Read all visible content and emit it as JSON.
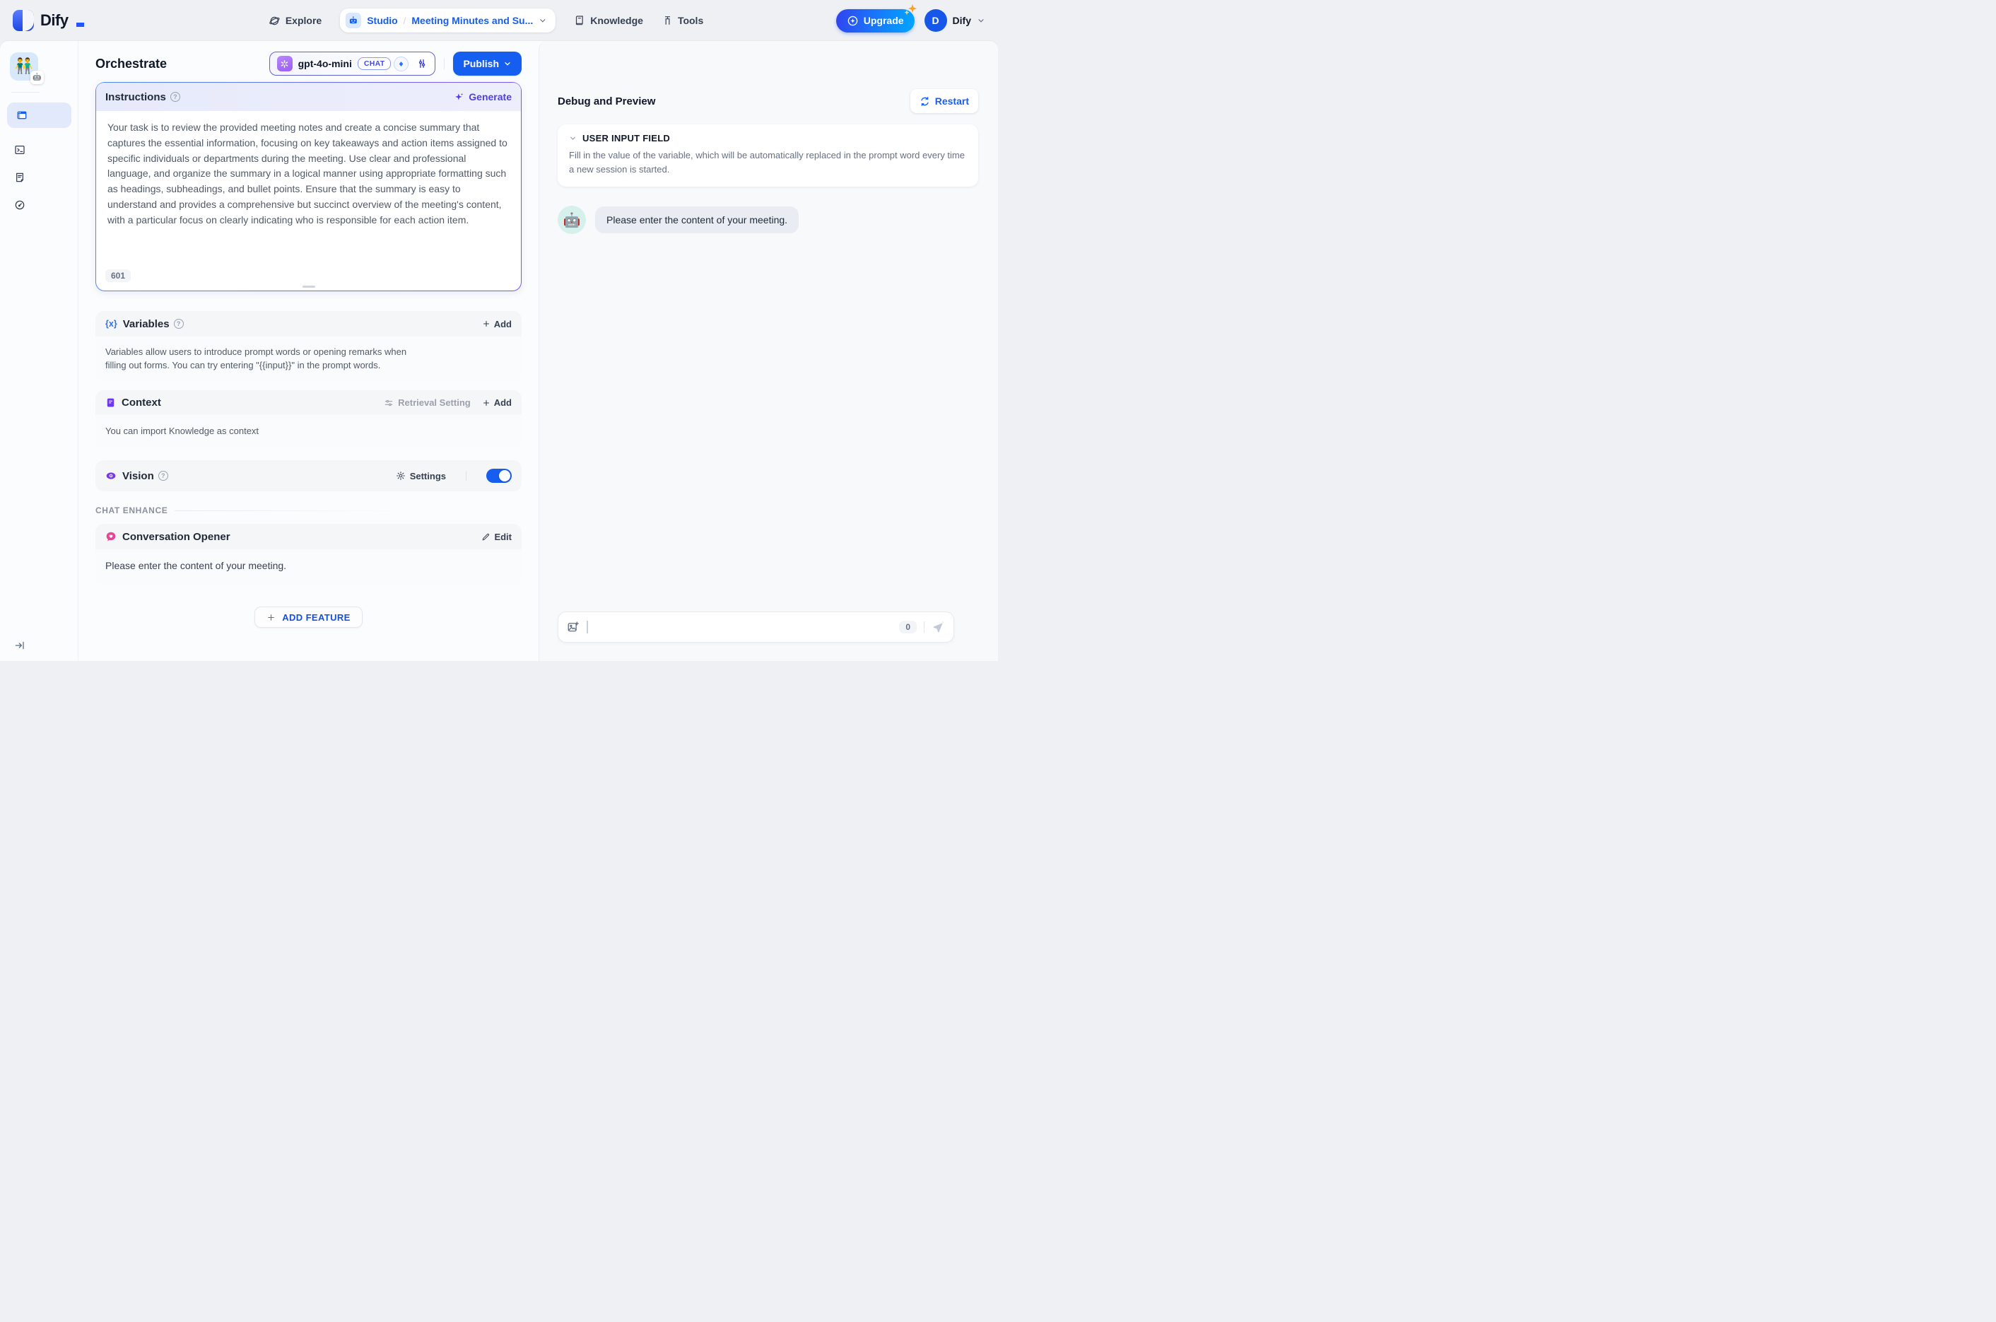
{
  "header": {
    "logo_text": "Dify",
    "nav": {
      "explore": "Explore",
      "studio": "Studio",
      "separator": "/",
      "app_name": "Meeting Minutes and Su...",
      "knowledge": "Knowledge",
      "tools": "Tools"
    },
    "upgrade_label": "Upgrade",
    "account": {
      "avatar_initial": "D",
      "name": "Dify"
    }
  },
  "sidebar": {
    "app_icon_emoji": "👬",
    "app_badge_emoji": "🤖"
  },
  "toolbar": {
    "page_title": "Orchestrate",
    "model": {
      "name": "gpt-4o-mini",
      "mode": "CHAT"
    },
    "publish_label": "Publish"
  },
  "instructions": {
    "title": "Instructions",
    "generate_label": "Generate",
    "text": "Your task is to review the provided meeting notes and create a concise summary that captures the essential information, focusing on key takeaways and action items assigned to specific individuals or departments during the meeting. Use clear and professional language, and organize the summary in a logical manner using appropriate formatting such as headings, subheadings, and bullet points. Ensure that the summary is easy to understand and provides a comprehensive but succinct overview of the meeting's content, with a particular focus on clearly indicating who is responsible for each action item.",
    "char_count": "601"
  },
  "variables": {
    "title": "Variables",
    "add_label": "Add",
    "description": "Variables allow users to introduce prompt words or opening remarks when filling out forms. You can try entering \"{{input}}\" in the prompt words."
  },
  "context": {
    "title": "Context",
    "retrieval_setting_label": "Retrieval Setting",
    "add_label": "Add",
    "description": "You can import Knowledge as context"
  },
  "vision": {
    "title": "Vision",
    "settings_label": "Settings",
    "enabled": true
  },
  "chat_enhance": {
    "section_label": "CHAT ENHANCE",
    "opener": {
      "title": "Conversation Opener",
      "edit_label": "Edit",
      "message": "Please enter the content of your meeting."
    }
  },
  "add_feature_label": "ADD FEATURE",
  "debug": {
    "title": "Debug and Preview",
    "restart_label": "Restart",
    "user_input_field": {
      "title": "USER INPUT FIELD",
      "description": "Fill in the value of the variable, which will be automatically replaced in the prompt word every time a new session is started."
    },
    "bot": {
      "avatar_emoji": "🤖",
      "message": "Please enter the content of your meeting."
    },
    "input": {
      "char_count": "0"
    }
  },
  "colors": {
    "primary_blue": "#155eef",
    "indigo": "#4e40e4",
    "purple": "#6938ef",
    "pink": "#e74694"
  }
}
